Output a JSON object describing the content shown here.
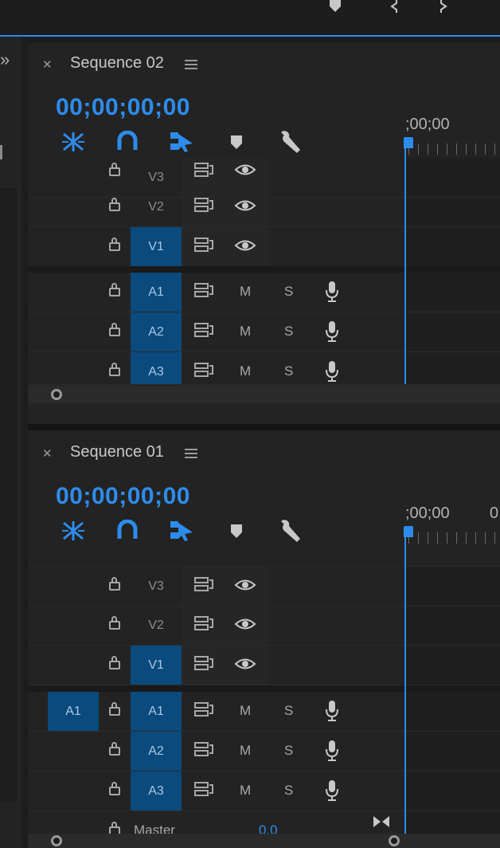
{
  "top_icons": [
    "marker-icon",
    "bracket-left-icon",
    "bracket-right-icon"
  ],
  "expand_glyph": "»",
  "panels": [
    {
      "title": "Sequence 02",
      "timecode": "00;00;00;00",
      "ruler_labels": [
        ";00;00"
      ],
      "tools": [
        "ripple-insert-icon",
        "snap-magnet-icon",
        "linked-selection-icon",
        "add-marker-icon",
        "settings-wrench-icon"
      ],
      "video_tracks": [
        {
          "label": "V3",
          "targeted": false
        },
        {
          "label": "V2",
          "targeted": false
        },
        {
          "label": "V1",
          "targeted": true
        }
      ],
      "audio_tracks": [
        {
          "label": "A1",
          "targeted": true,
          "m": "M",
          "s": "S"
        },
        {
          "label": "A2",
          "targeted": true,
          "m": "M",
          "s": "S"
        },
        {
          "label": "A3",
          "targeted": true,
          "m": "M",
          "s": "S"
        }
      ]
    },
    {
      "title": "Sequence 01",
      "timecode": "00;00;00;00",
      "ruler_labels": [
        ";00;00",
        "0"
      ],
      "tools": [
        "ripple-insert-icon",
        "snap-magnet-icon",
        "linked-selection-icon",
        "add-marker-icon",
        "settings-wrench-icon"
      ],
      "source_patch": "A1",
      "video_tracks": [
        {
          "label": "V3",
          "targeted": false
        },
        {
          "label": "V2",
          "targeted": false
        },
        {
          "label": "V1",
          "targeted": true
        }
      ],
      "audio_tracks": [
        {
          "label": "A1",
          "targeted": true,
          "m": "M",
          "s": "S"
        },
        {
          "label": "A2",
          "targeted": true,
          "m": "M",
          "s": "S"
        },
        {
          "label": "A3",
          "targeted": true,
          "m": "M",
          "s": "S"
        }
      ],
      "master": {
        "label": "Master",
        "value": "0.0"
      }
    }
  ],
  "colors": {
    "accent": "#2d8ceb",
    "target": "#0b4a7c",
    "panel": "#232323",
    "bg": "#1d1d1d"
  }
}
